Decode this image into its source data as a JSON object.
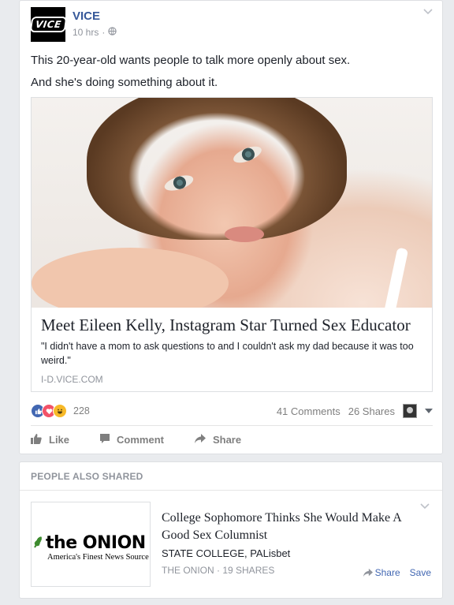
{
  "post": {
    "page_name": "VICE",
    "logo_text": "VICE",
    "time": "10 hrs",
    "separator": "·",
    "text_lines": [
      "This 20-year-old wants people to talk more openly about sex.",
      "And she's doing something about it."
    ],
    "link": {
      "title": "Meet Eileen Kelly, Instagram Star Turned Sex Educator",
      "description": "\"I didn't have a mom to ask questions to and I couldn't ask my dad because it was too weird.\"",
      "domain": "I-D.VICE.COM"
    },
    "reactions": {
      "count": "228"
    },
    "comments": "41 Comments",
    "shares": "26 Shares",
    "actions": {
      "like": "Like",
      "comment": "Comment",
      "share": "Share"
    }
  },
  "people_also_shared": {
    "heading": "PEOPLE ALSO SHARED",
    "item": {
      "logo_main": "the ONION",
      "logo_sub": "America's Finest News Source",
      "title": "College Sophomore Thinks She Would Make A Good Sex Columnist",
      "subtitle": "STATE COLLEGE, PALisbet",
      "meta": "THE ONION · 19 SHARES",
      "share": "Share",
      "save": "Save"
    }
  },
  "colors": {
    "link_blue": "#365899",
    "fb_blue": "#4267b2",
    "muted": "#90949c",
    "love_red": "#f25268",
    "haha_yellow": "#f7b928"
  },
  "icons": [
    "globe-icon",
    "chevron-down-icon",
    "like-icon",
    "love-icon",
    "haha-icon",
    "thumbs-up-icon",
    "comment-icon",
    "share-arrow-icon",
    "dropdown-caret-icon"
  ]
}
